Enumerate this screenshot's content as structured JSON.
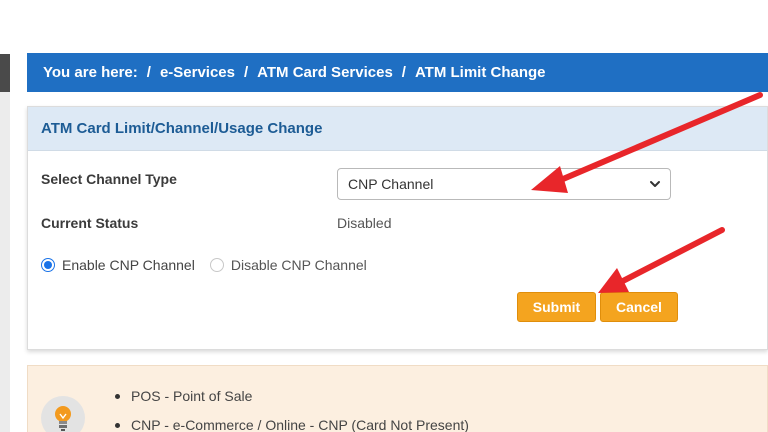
{
  "breadcrumb": {
    "prefix": "You are here:",
    "separator": "/",
    "items": [
      "e-Services",
      "ATM Card Services",
      "ATM Limit Change"
    ]
  },
  "panel": {
    "title": "ATM Card Limit/Channel/Usage Change",
    "channel_label": "Select Channel Type",
    "channel_value": "CNP Channel",
    "status_label": "Current Status",
    "status_value": "Disabled",
    "radio_enable": "Enable CNP Channel",
    "radio_disable": "Disable CNP Channel",
    "selected_radio": "enable",
    "submit_label": "Submit",
    "cancel_label": "Cancel"
  },
  "info": {
    "icon": "lightbulb-icon",
    "items": [
      "POS - Point of Sale",
      "CNP - e-Commerce / Online - CNP (Card Not Present)"
    ]
  },
  "colors": {
    "breadcrumb_bg": "#1f6fc3",
    "panel_head_bg": "#dde9f5",
    "button_bg": "#f4a41f",
    "annotation_arrow": "#e8262a",
    "info_bg": "#fcefe0"
  }
}
